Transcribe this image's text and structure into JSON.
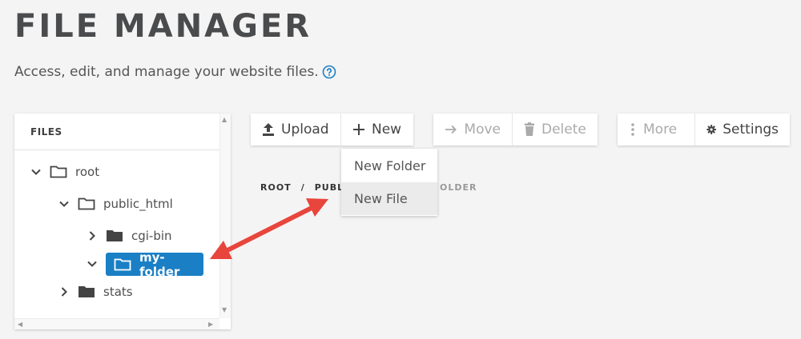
{
  "header": {
    "title": "FILE MANAGER",
    "subtitle": "Access, edit, and manage your website files."
  },
  "tree": {
    "header": "FILES",
    "nodes": [
      {
        "label": "root",
        "expanded": true
      },
      {
        "label": "public_html",
        "expanded": true
      },
      {
        "label": "cgi-bin",
        "expanded": false
      },
      {
        "label": "my-folder",
        "expanded": true,
        "selected": true
      },
      {
        "label": "stats",
        "expanded": false
      }
    ]
  },
  "toolbar": {
    "upload": "Upload",
    "new": "New",
    "move": "Move",
    "delete": "Delete",
    "more": "More",
    "settings": "Settings"
  },
  "breadcrumb": {
    "root": "ROOT",
    "separator": "/",
    "public": "PUBL",
    "tail": "OLDER"
  },
  "new_menu": {
    "items": [
      "New Folder",
      "New File"
    ],
    "highlighted": "New File"
  },
  "colors": {
    "accent": "#1a7fc5",
    "annotation_arrow": "#e8453c"
  }
}
